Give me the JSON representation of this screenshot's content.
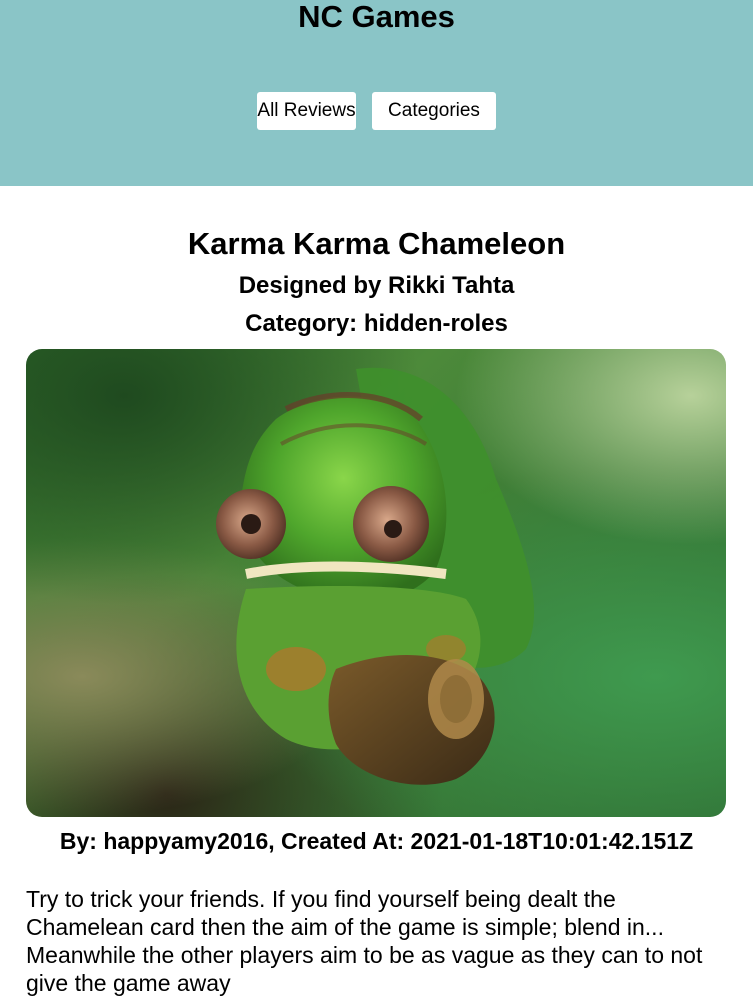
{
  "site": {
    "title": "NC Games"
  },
  "nav": {
    "all_reviews_label": "All Reviews",
    "categories_label": "Categories"
  },
  "review": {
    "title": "Karma Karma Chameleon",
    "designer_line": "Designed by Rikki Tahta",
    "category_line": "Category: hidden-roles",
    "image_alt": "chameleon",
    "byline": "By: happyamy2016, Created At: 2021-01-18T10:01:42.151Z",
    "body": "Try to trick your friends. If you find yourself being dealt the Chamelean card then the aim of the game is simple; blend in... Meanwhile the other players aim to be as vague as they can to not give the game away"
  },
  "colors": {
    "header_bg": "#8ac5c7",
    "button_bg": "#ffffff"
  }
}
